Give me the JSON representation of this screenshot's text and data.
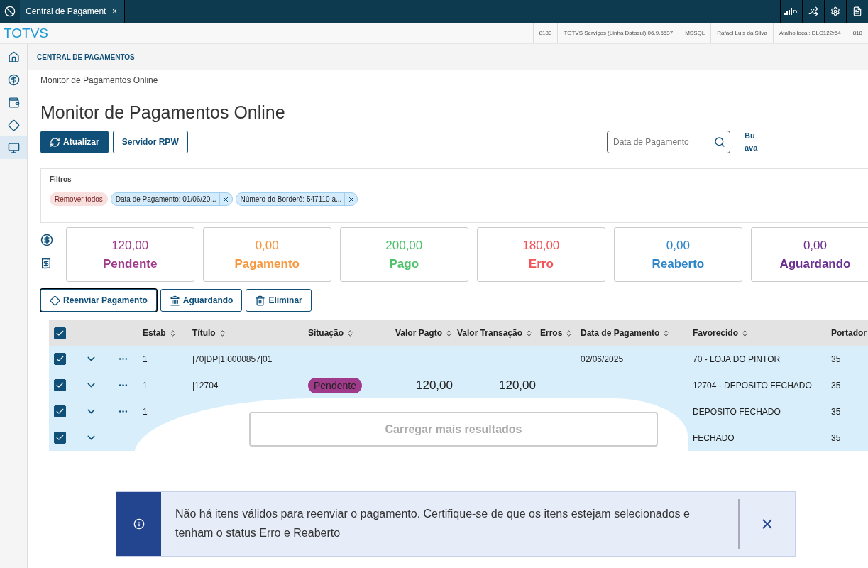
{
  "top_bar": {
    "tab": {
      "label": "Central de Pagament",
      "close": "×",
      "selected": true
    },
    "signal_label": "DI"
  },
  "info_bar": {
    "logo": "TOTVS",
    "items": [
      "8183",
      "TOTVS Serviços (Linha Datasul) 06.9.5537",
      "MSSQL",
      "Rafael Luis da Silva",
      "Atalho local: DLC122r64",
      "818"
    ]
  },
  "sidebar": {
    "items": [
      {
        "selected": false
      },
      {
        "selected": false
      },
      {
        "selected": false
      },
      {
        "selected": false
      },
      {
        "selected": true
      }
    ]
  },
  "section_title": "CENTRAL DE PAGAMENTOS",
  "breadcrumb": "Monitor de Pagamentos Online",
  "title": "Monitor de Pagamentos Online",
  "actions": [
    {
      "label": "Atualizar",
      "kind": "primary"
    },
    {
      "label": "Servidor RPW",
      "kind": "secondary"
    }
  ],
  "search": {
    "placeholder": "Data de Pagamento"
  },
  "advanced_search_link": "Bu ava",
  "filters": {
    "title": "Filtros",
    "clear": "Remover todos",
    "chips": [
      "Data de Pagamento: 01/06/20...",
      "Número do Borderô: 547110 a..."
    ]
  },
  "summary": [
    {
      "value": "120,00",
      "label": "Pendente",
      "color": "#a03a8a"
    },
    {
      "value": "0,00",
      "label": "Pagamento",
      "color": "#f7963b"
    },
    {
      "value": "200,00",
      "label": "Pago",
      "color": "#4cc26a"
    },
    {
      "value": "180,00",
      "label": "Erro",
      "color": "#f2545b"
    },
    {
      "value": "0,00",
      "label": "Reaberto",
      "color": "#2c85c8"
    },
    {
      "value": "0,00",
      "label": "Aguardando",
      "color": "#6b2d8e"
    }
  ],
  "row_actions": [
    {
      "label": "Reenviar Pagamento",
      "focused": true
    },
    {
      "label": "Aguardando",
      "focused": false
    },
    {
      "label": "Eliminar",
      "focused": false
    }
  ],
  "table": {
    "all_checked": true,
    "columns": [
      "Estab",
      "Título",
      "Situação",
      "Valor Pagto",
      "Valor Transação",
      "Erros",
      "Data de Pagamento",
      "Favorecido",
      "Portador"
    ],
    "rows": [
      {
        "checked": true,
        "expand": true,
        "menu": true,
        "estab": "1",
        "titulo": "|70|DP|1|0000857|01",
        "situacao": "",
        "valor_pagto": "",
        "valor_transacao": "",
        "data": "02/06/2025",
        "favorecido": "70 - LOJA DO PINTOR",
        "portador": "35"
      },
      {
        "checked": true,
        "expand": true,
        "menu": true,
        "estab": "1",
        "titulo": "|12704",
        "situacao": "Pendente",
        "valor_pagto": "120,00",
        "valor_transacao": "120,00",
        "data": "",
        "favorecido": "12704 - DEPOSITO FECHADO",
        "portador": "35"
      },
      {
        "checked": true,
        "expand": true,
        "menu": true,
        "estab": "1",
        "titulo": "",
        "situacao": "",
        "valor_pagto": "",
        "valor_transacao": "",
        "data": "",
        "favorecido": "DEPOSITO FECHADO",
        "portador": "35"
      },
      {
        "checked": true,
        "expand": true,
        "menu": false,
        "estab": "",
        "titulo": "",
        "situacao": "",
        "valor_pagto": "",
        "valor_transacao": "",
        "data": "",
        "favorecido": "FECHADO",
        "portador": "35"
      }
    ],
    "load_more": "Carregar mais resultados"
  },
  "toast": {
    "message": "Não há itens válidos para reenviar o pagamento. Certifique-se de que os itens estejam selecionados e tenham o status Erro e Reaberto"
  }
}
